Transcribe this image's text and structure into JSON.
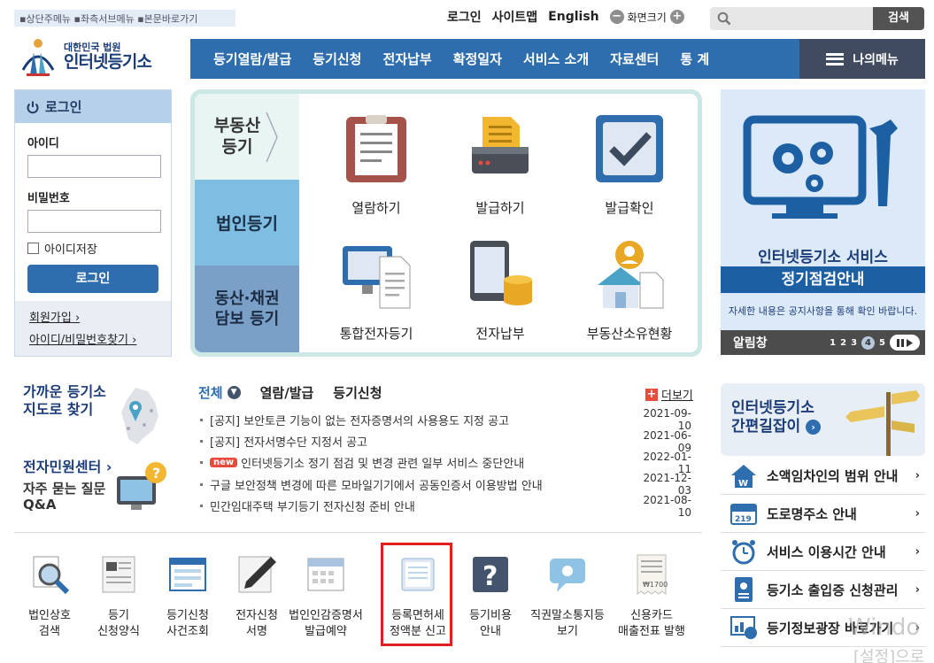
{
  "skip_links": "▪상단주메뉴 ▪좌측서브메뉴 ▪본문바로가기",
  "toplinks": {
    "login": "로그인",
    "sitemap": "사이트맵",
    "english": "English",
    "zoom": "화면크기"
  },
  "search": {
    "button": "검색",
    "placeholder": ""
  },
  "logo": {
    "line1": "대한민국 법원",
    "line2": "인터넷등기소"
  },
  "gnb": [
    "등기열람/발급",
    "등기신청",
    "전자납부",
    "확정일자",
    "서비스 소개",
    "자료센터",
    "통 계"
  ],
  "my_menu": "나의메뉴",
  "login": {
    "title": "로그인",
    "id_label": "아이디",
    "pw_label": "비밀번호",
    "save_id": "아이디저장",
    "button": "로그인",
    "join": "회원가입",
    "find": "아이디/비밀번호찾기"
  },
  "center": {
    "tabs": [
      "부동산\n등기",
      "법인등기",
      "동산·채권\n담보 등기"
    ],
    "services": [
      "열람하기",
      "발급하기",
      "발급확인",
      "통합전자등기",
      "전자납부",
      "부동산소유현황"
    ]
  },
  "banner": {
    "title": "인터넷등기소 서비스",
    "highlight": "정기점검안내",
    "desc": "자세한 내용은 공지사항을 통해 확인 바랍니다.",
    "bar_label": "알림창",
    "pages": [
      "1",
      "2",
      "3",
      "4",
      "5"
    ],
    "active_page": "4"
  },
  "left_mid": {
    "near_title": "가까운 등기소\n지도로 찾기",
    "civil_title": "전자민원센터",
    "civil_sub": "자주 묻는 질문\nQ&A"
  },
  "notice": {
    "tabs": [
      "전체",
      "열람/발급",
      "등기신청"
    ],
    "more": "더보기",
    "items": [
      {
        "title": "[공지] 보안토큰 기능이 없는 전자증명서의 사용용도 지정 공고",
        "date": "2021-09-10",
        "new": false
      },
      {
        "title": "[공지] 전자서명수단 지정서 공고",
        "date": "2021-06-09",
        "new": false
      },
      {
        "title": "인터넷등기소 정기 점검 및 변경 관련 일부 서비스 중단안내",
        "date": "2022-01-11",
        "new": true
      },
      {
        "title": "구글 보안정책 변경에 따른 모바일기기에서 공동인증서 이용방법 안내",
        "date": "2021-12-03",
        "new": false
      },
      {
        "title": "민간임대주택 부기등기 전자신청 준비 안내",
        "date": "2021-08-10",
        "new": false
      }
    ],
    "new_badge": "new"
  },
  "quick": [
    "법인상호\n검색",
    "등기\n신청양식",
    "등기신청\n사건조회",
    "전자신청\n서명",
    "법인인감증명서\n발급예약",
    "등록면허세\n정액분 신고",
    "등기비용\n안내",
    "직권말소통지등\n보기",
    "신용카드\n매출전표 발행"
  ],
  "easy_guide": "인터넷등기소\n간편길잡이",
  "right_list": [
    "소액임차인의 범위 안내",
    "도로명주소 안내",
    "서비스 이용시간 안내",
    "등기소 출입증 신청관리",
    "등기정보광장 바로가기"
  ],
  "watermark": {
    "line1": "Windo",
    "line2": "[설정]으로"
  },
  "colors": {
    "primary": "#2f6eae",
    "dark": "#404b5f",
    "highlight": "#e02020"
  }
}
